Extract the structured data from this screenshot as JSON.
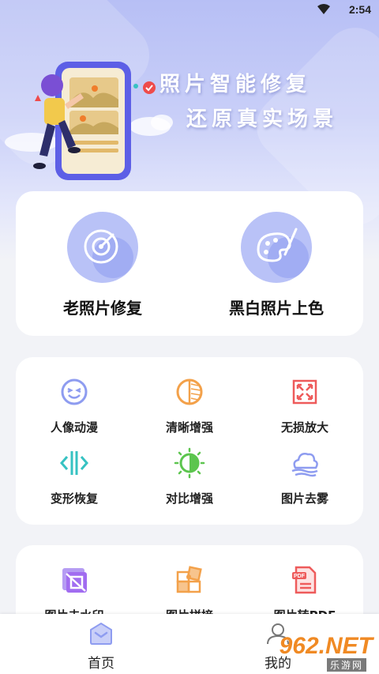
{
  "status_bar": {
    "time": "2:54"
  },
  "hero": {
    "title_line1": "照片智能修复",
    "title_line2": "还原真实场景"
  },
  "primary_features": [
    {
      "label": "老照片修复",
      "icon": "radar-icon"
    },
    {
      "label": "黑白照片上色",
      "icon": "palette-icon"
    }
  ],
  "tools": [
    {
      "label": "人像动漫",
      "icon": "smile-face-icon"
    },
    {
      "label": "清晰增强",
      "icon": "half-circle-icon"
    },
    {
      "label": "无损放大",
      "icon": "expand-icon"
    },
    {
      "label": "变形恢复",
      "icon": "split-arrows-icon"
    },
    {
      "label": "对比增强",
      "icon": "contrast-icon"
    },
    {
      "label": "图片去雾",
      "icon": "cloud-icon"
    }
  ],
  "more_tools": [
    {
      "label": "图片去水印",
      "icon": "watermark-icon"
    },
    {
      "label": "图片拼接",
      "icon": "puzzle-icon"
    },
    {
      "label": "图片转PDF",
      "icon": "pdf-icon",
      "badge": "PDF"
    }
  ],
  "bottom_nav": [
    {
      "label": "首页",
      "icon": "home-icon"
    },
    {
      "label": "我的",
      "icon": "profile-icon"
    }
  ],
  "watermark": {
    "text": "962.NET",
    "sub": "乐游网"
  },
  "colors": {
    "accent": "#8e9cf0",
    "primary_circle": "#b9c2f7",
    "orange": "#f3a14a",
    "red": "#ee5b5b",
    "teal": "#36c2c2",
    "green": "#5cc54e",
    "purple": "#a16cf0"
  }
}
